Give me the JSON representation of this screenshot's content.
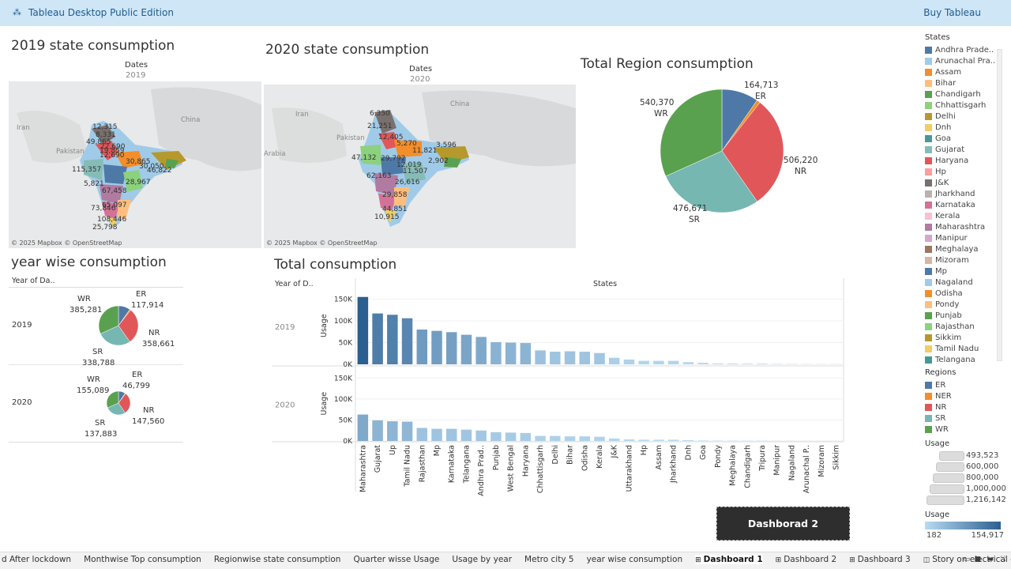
{
  "topbar": {
    "title": "Tableau Desktop Public Edition",
    "buy": "Buy Tableau"
  },
  "map2019": {
    "title": "2019 state consumption",
    "dates_label": "Dates",
    "year": "2019",
    "credit": "© 2025 Mapbox © OpenStreetMap",
    "geo": [
      "China",
      "Iran",
      "Pakistan"
    ],
    "values": [
      "12,315",
      "8,331",
      "49,865",
      "22,690",
      "12,690",
      "30,865",
      "19,859",
      "115,357",
      "30,050",
      "46,822",
      "5,821",
      "67,458",
      "28,967",
      "65,097",
      "73,846",
      "108,446",
      "25,798"
    ]
  },
  "map2020": {
    "title": "2020 state consumption",
    "dates_label": "Dates",
    "year": "2020",
    "credit": "© 2025 Mapbox © OpenStreetMap",
    "geo": [
      "China",
      "Iran",
      "Pakistan",
      "Arabia"
    ],
    "values": [
      "6,350",
      "21,251",
      "12,405",
      "5,270",
      "11,821",
      "3,596",
      "47,132",
      "29,792",
      "12,019",
      "2,902",
      "11,507",
      "26,616",
      "62,163",
      "29,858",
      "44,851",
      "10,915"
    ]
  },
  "region_pie": {
    "title": "Total Region consumption",
    "slices": [
      {
        "name": "ER",
        "value": 164713,
        "label": "164,713",
        "color": "#4e79a7"
      },
      {
        "name": "NER",
        "value": 15500,
        "label": "",
        "color": "#f28e2b"
      },
      {
        "name": "NR",
        "value": 506220,
        "label": "506,220",
        "color": "#e15759"
      },
      {
        "name": "SR",
        "value": 476671,
        "label": "476,671",
        "color": "#76b7b2"
      },
      {
        "name": "WR",
        "value": 540370,
        "label": "540,370",
        "color": "#59a14f"
      }
    ]
  },
  "yearwise": {
    "title": "year wise consumption",
    "year_header": "Year of Da..",
    "rows": [
      {
        "year": "2019",
        "slices": [
          {
            "name": "ER",
            "value": 117914,
            "label": "117,914",
            "color": "#4e79a7"
          },
          {
            "name": "NER",
            "value": 11000,
            "label": "",
            "color": "#f28e2b"
          },
          {
            "name": "NR",
            "value": 358661,
            "label": "358,661",
            "color": "#e15759"
          },
          {
            "name": "SR",
            "value": 338788,
            "label": "338,788",
            "color": "#76b7b2"
          },
          {
            "name": "WR",
            "value": 385281,
            "label": "385,281",
            "color": "#59a14f"
          }
        ]
      },
      {
        "year": "2020",
        "slices": [
          {
            "name": "ER",
            "value": 46799,
            "label": "46,799",
            "color": "#4e79a7"
          },
          {
            "name": "NER",
            "value": 4500,
            "label": "",
            "color": "#f28e2b"
          },
          {
            "name": "NR",
            "value": 147560,
            "label": "147,560",
            "color": "#e15759"
          },
          {
            "name": "SR",
            "value": 137883,
            "label": "137,883",
            "color": "#76b7b2"
          },
          {
            "name": "WR",
            "value": 155089,
            "label": "155,089",
            "color": "#59a14f"
          }
        ]
      }
    ]
  },
  "chart_data": {
    "type": "bar",
    "title": "Total consumption",
    "row_header": "Year of D..",
    "column_header": "States",
    "ylabel": "Usage",
    "ylim": [
      0,
      160000
    ],
    "yticks": [
      "150K",
      "100K",
      "50K",
      "0K"
    ],
    "ytick_values": [
      150000,
      100000,
      50000,
      0
    ],
    "color_range": [
      "#b9dbf2",
      "#2b5f91"
    ],
    "categories": [
      "Maharashtra",
      "Gujarat",
      "Up",
      "Tamil Nadu",
      "Rajasthan",
      "Mp",
      "Karnataka",
      "Telangana",
      "Andhra Prad..",
      "Punjab",
      "West Bengal",
      "Haryana",
      "Chhattisgarh",
      "Delhi",
      "Bihar",
      "Odisha",
      "Kerala",
      "J&K",
      "Uttarakhand",
      "Hp",
      "Assam",
      "Jharkhand",
      "Dnh",
      "Goa",
      "Pondy",
      "Meghalaya",
      "Chandigarh",
      "Tripura",
      "Manipur",
      "Nagaland",
      "Arunachal P..",
      "Mizoram",
      "Sikkim"
    ],
    "series": [
      {
        "name": "2019",
        "values": [
          155000,
          117000,
          114000,
          106000,
          80000,
          77000,
          74000,
          68000,
          63000,
          51000,
          50000,
          49000,
          32000,
          29000,
          30000,
          29000,
          26000,
          15000,
          11000,
          8000,
          8000,
          8000,
          5000,
          3500,
          2000,
          1800,
          1500,
          1500,
          1000,
          700,
          600,
          500,
          400
        ]
      },
      {
        "name": "2020",
        "values": [
          63000,
          49000,
          47000,
          46000,
          31000,
          29000,
          29000,
          27000,
          25000,
          21000,
          20000,
          19000,
          12000,
          12000,
          11000,
          11000,
          10000,
          6000,
          4000,
          3000,
          3000,
          3000,
          2000,
          1200,
          900,
          700,
          600,
          600,
          400,
          300,
          250,
          200,
          150
        ]
      }
    ]
  },
  "legend": {
    "states_title": "States",
    "states": [
      {
        "label": "Andhra Prade..",
        "color": "#4e79a7"
      },
      {
        "label": "Arunachal Pra..",
        "color": "#a0cbe8"
      },
      {
        "label": "Assam",
        "color": "#f28e2b"
      },
      {
        "label": "Bihar",
        "color": "#ffbe7d"
      },
      {
        "label": "Chandigarh",
        "color": "#59a14f"
      },
      {
        "label": "Chhattisgarh",
        "color": "#8cd17d"
      },
      {
        "label": "Delhi",
        "color": "#b6992d"
      },
      {
        "label": "Dnh",
        "color": "#f1ce63"
      },
      {
        "label": "Goa",
        "color": "#499894"
      },
      {
        "label": "Gujarat",
        "color": "#86bcb6"
      },
      {
        "label": "Haryana",
        "color": "#e15759"
      },
      {
        "label": "Hp",
        "color": "#ff9d9a"
      },
      {
        "label": "J&K",
        "color": "#79706e"
      },
      {
        "label": "Jharkhand",
        "color": "#bab0ac"
      },
      {
        "label": "Karnataka",
        "color": "#d37295"
      },
      {
        "label": "Kerala",
        "color": "#fabfd2"
      },
      {
        "label": "Maharashtra",
        "color": "#b07aa1"
      },
      {
        "label": "Manipur",
        "color": "#d4a6c8"
      },
      {
        "label": "Meghalaya",
        "color": "#9d7660"
      },
      {
        "label": "Mizoram",
        "color": "#d7b5a6"
      },
      {
        "label": "Mp",
        "color": "#4e79a7"
      },
      {
        "label": "Nagaland",
        "color": "#a0cbe8"
      },
      {
        "label": "Odisha",
        "color": "#f28e2b"
      },
      {
        "label": "Pondy",
        "color": "#ffbe7d"
      },
      {
        "label": "Punjab",
        "color": "#59a14f"
      },
      {
        "label": "Rajasthan",
        "color": "#8cd17d"
      },
      {
        "label": "Sikkim",
        "color": "#b6992d"
      },
      {
        "label": "Tamil Nadu",
        "color": "#f1ce63"
      },
      {
        "label": "Telangana",
        "color": "#499894"
      }
    ],
    "regions_title": "Regions",
    "regions": [
      {
        "label": "ER",
        "color": "#4e79a7"
      },
      {
        "label": "NER",
        "color": "#f28e2b"
      },
      {
        "label": "NR",
        "color": "#e15759"
      },
      {
        "label": "SR",
        "color": "#76b7b2"
      },
      {
        "label": "WR",
        "color": "#59a14f"
      }
    ],
    "usage_size_title": "Usage",
    "usage_sizes": [
      "493,523",
      "600,000",
      "800,000",
      "1,000,000",
      "1,216,142"
    ],
    "usage_color_title": "Usage",
    "usage_min": "182",
    "usage_max": "154,917"
  },
  "dash_button": "Dashborad 2",
  "tabs": [
    {
      "label": "d After lockdown",
      "icon": ""
    },
    {
      "label": "Monthwise Top consumption",
      "icon": ""
    },
    {
      "label": "Regionwise state consumption",
      "icon": ""
    },
    {
      "label": "Quarter wisse Usage",
      "icon": ""
    },
    {
      "label": "Usage by year",
      "icon": ""
    },
    {
      "label": "Metro city 5",
      "icon": ""
    },
    {
      "label": "year wise consumption",
      "icon": ""
    },
    {
      "label": "Dashboard 1",
      "icon": "⊞",
      "active": true
    },
    {
      "label": "Dashboard 2",
      "icon": "⊞"
    },
    {
      "label": "Dashboard 3",
      "icon": "⊞"
    },
    {
      "label": "Story on electrical consumpti...",
      "icon": "◫"
    }
  ]
}
